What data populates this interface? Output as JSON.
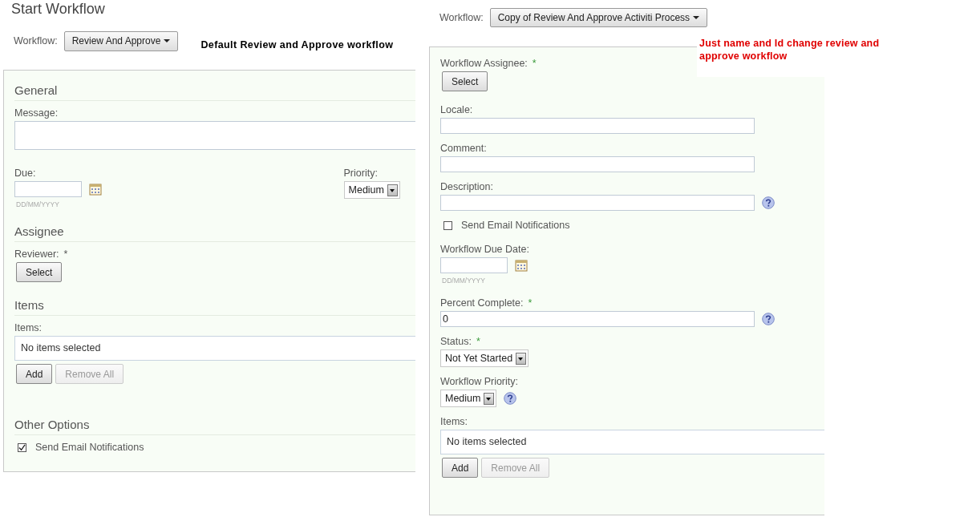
{
  "left": {
    "title": "Start Workflow",
    "workflow_label": "Workflow:",
    "workflow_button": "Review And Approve",
    "note": "Default Review and Approve workflow",
    "sections": [
      {
        "heading": "General",
        "fields": [
          {
            "kind": "textarea",
            "label": "Message:"
          },
          {
            "kind": "row",
            "fields": [
              {
                "kind": "date",
                "label": "Due:",
                "hint": "DD/MM/YYYY"
              },
              {
                "kind": "select",
                "label": "Priority:",
                "value": "Medium"
              }
            ]
          }
        ]
      },
      {
        "heading": "Assignee",
        "fields": [
          {
            "kind": "picker",
            "label": "Reviewer:",
            "required_mark": "*",
            "button": "Select"
          }
        ]
      },
      {
        "heading": "Items",
        "fields": [
          {
            "kind": "items",
            "label": "Items:",
            "value": "No items selected",
            "buttons": [
              {
                "label": "Add",
                "disabled": false
              },
              {
                "label": "Remove All",
                "disabled": true
              }
            ]
          }
        ]
      },
      {
        "heading": "Other Options",
        "fields": [
          {
            "kind": "checkbox",
            "label": "Send Email Notifications",
            "checked": true
          }
        ]
      }
    ]
  },
  "right": {
    "workflow_label": "Workflow:",
    "workflow_button": "Copy of Review And Approve Activiti Process",
    "annotation": "Just name and Id change review and approve workflow",
    "fields": [
      {
        "kind": "picker",
        "label": "Workflow Assignee:",
        "required_mark": "*",
        "button": "Select"
      },
      {
        "kind": "text",
        "label": "Locale:"
      },
      {
        "kind": "text",
        "label": "Comment:"
      },
      {
        "kind": "text",
        "label": "Description:",
        "help": true
      },
      {
        "kind": "checkbox",
        "label": "Send Email Notifications",
        "checked": false
      },
      {
        "kind": "date",
        "label": "Workflow Due Date:",
        "hint": "DD/MM/YYYY"
      },
      {
        "kind": "text",
        "label": "Percent Complete:",
        "required_mark": "*",
        "value": "0",
        "help": true
      },
      {
        "kind": "select",
        "label": "Status:",
        "required_mark": "*",
        "value": "Not Yet Started"
      },
      {
        "kind": "select",
        "label": "Workflow Priority:",
        "value": "Medium",
        "help": true
      },
      {
        "kind": "items",
        "label": "Items:",
        "value": "No items selected",
        "buttons": [
          {
            "label": "Add",
            "disabled": false
          },
          {
            "label": "Remove All",
            "disabled": true
          }
        ]
      }
    ]
  }
}
